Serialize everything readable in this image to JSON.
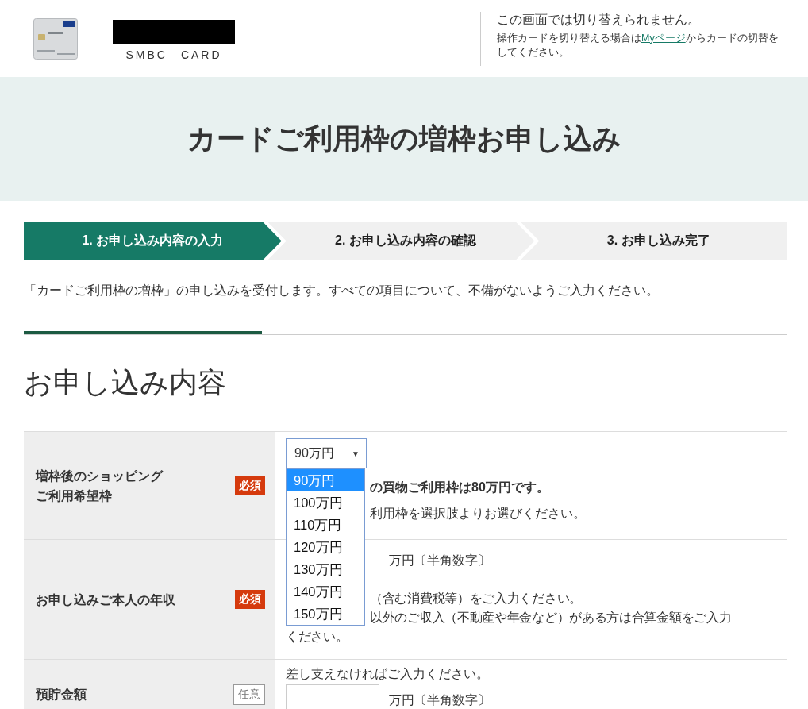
{
  "header": {
    "brand": "SMBC　CARD",
    "notice_title": "この画面では切り替えられません。",
    "notice_before": "操作カードを切り替える場合は",
    "notice_link": "Myページ",
    "notice_after": "からカードの切替をしてください。"
  },
  "banner": {
    "title": "カードご利用枠の増枠お申し込み"
  },
  "steps": [
    {
      "label": "1. お申し込み内容の入力",
      "selected": true
    },
    {
      "label": "2. お申し込み内容の確認",
      "selected": false
    },
    {
      "label": "3. お申し込み完了",
      "selected": false
    }
  ],
  "intro": "「カードご利用枠の増枠」の申し込みを受付します。すべての項目について、不備がないようご入力ください。",
  "section_title": "お申し込み内容",
  "rows": [
    {
      "kind": "select",
      "label_lines": [
        "増枠後のショッピング",
        "ご利用希望枠"
      ],
      "badge": {
        "text": "必須",
        "kind": "required"
      },
      "select": {
        "value": "90万円",
        "caret": "▼",
        "expanded": true,
        "options": [
          {
            "label": "90万円",
            "selected": true
          },
          {
            "label": "100万円",
            "selected": false
          },
          {
            "label": "110万円",
            "selected": false
          },
          {
            "label": "120万円",
            "selected": false
          },
          {
            "label": "130万円",
            "selected": false
          },
          {
            "label": "140万円",
            "selected": false
          },
          {
            "label": "150万円",
            "selected": false
          }
        ]
      },
      "note_bold": "の買物ご利用枠は80万円です。",
      "note": "利用枠を選択肢よりお選びください。"
    },
    {
      "kind": "amount",
      "label_lines": [
        "お申し込みご本人の年収"
      ],
      "badge": {
        "text": "必須",
        "kind": "required"
      },
      "unit": "万円〔半角数字〕",
      "notes": [
        "（含む消費税等）をご入力ください。",
        "以外のご収入（不動産や年金など）がある方は合算金額をご入力",
        "ください。"
      ]
    },
    {
      "kind": "amount_hint",
      "label_lines": [
        "預貯金額"
      ],
      "badge": {
        "text": "任意",
        "kind": "optional"
      },
      "hint": "差し支えなければご入力ください。",
      "unit": "万円〔半角数字〕"
    }
  ]
}
